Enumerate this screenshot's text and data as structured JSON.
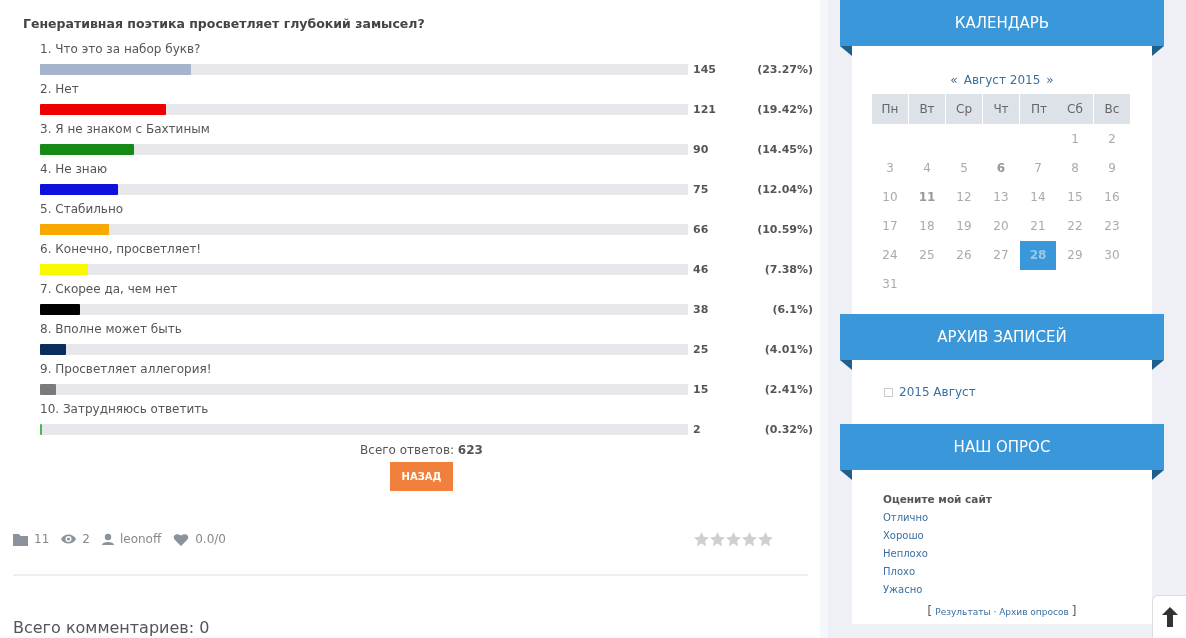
{
  "poll": {
    "question": "Генеративная поэтика просветляет глубокий замысел?",
    "answers": [
      {
        "label": "1. Что это за набор букв?",
        "count": "145",
        "percent": "(23.27%)",
        "level": 0.2327,
        "color": "#a3b4cc"
      },
      {
        "label": "2. Нет",
        "count": "121",
        "percent": "(19.42%)",
        "level": 0.1942,
        "color": "#ee0000"
      },
      {
        "label": "3. Я не знаком с Бахтиным",
        "count": "90",
        "percent": "(14.45%)",
        "level": 0.1445,
        "color": "#168a16"
      },
      {
        "label": "4. Не знаю",
        "count": "75",
        "percent": "(12.04%)",
        "level": 0.1204,
        "color": "#1010dd"
      },
      {
        "label": "5. Стабильно",
        "count": "66",
        "percent": "(10.59%)",
        "level": 0.1059,
        "color": "#f8a800"
      },
      {
        "label": "6. Конечно, просветляет!",
        "count": "46",
        "percent": "(7.38%)",
        "level": 0.0738,
        "color": "#f8f800"
      },
      {
        "label": "7. Скорее да, чем нет",
        "count": "38",
        "percent": "(6.1%)",
        "level": 0.061,
        "color": "#000000"
      },
      {
        "label": "8. Вполне может быть",
        "count": "25",
        "percent": "(4.01%)",
        "level": 0.0401,
        "color": "#0a2d5c"
      },
      {
        "label": "9. Просветляет аллегория!",
        "count": "15",
        "percent": "(2.41%)",
        "level": 0.0241,
        "color": "#7a7a7a"
      },
      {
        "label": "10. Затрудняюсь ответить",
        "count": "2",
        "percent": "(0.32%)",
        "level": 0.0032,
        "color": "#44bb44"
      }
    ],
    "total_label": "Всего ответов:",
    "total": "623",
    "back_button": "НАЗАД"
  },
  "meta": {
    "category": "11",
    "views": "2",
    "author": "leonoff",
    "rating": "0.0/0",
    "stars": 0
  },
  "comments": "Всего комментариев: 0",
  "calendar": {
    "title": "КАЛЕНДАРЬ",
    "prev": "«",
    "month": "Август 2015",
    "next": "»",
    "weekdays": [
      "Пн",
      "Вт",
      "Ср",
      "Чт",
      "Пт",
      "Сб",
      "Вс"
    ],
    "weeks": [
      [
        {
          "day": "1",
          "has_posts": false,
          "selected": false
        },
        {
          "day": "2",
          "has_posts": false,
          "selected": false
        }
      ],
      [
        {
          "day": "3",
          "has_posts": false,
          "selected": false
        },
        {
          "day": "4",
          "has_posts": false,
          "selected": false
        },
        {
          "day": "5",
          "has_posts": false,
          "selected": false
        },
        {
          "day": "6",
          "has_posts": true,
          "selected": false
        },
        {
          "day": "7",
          "has_posts": false,
          "selected": false
        },
        {
          "day": "8",
          "has_posts": false,
          "selected": false
        },
        {
          "day": "9",
          "has_posts": false,
          "selected": false
        }
      ],
      [
        {
          "day": "10",
          "has_posts": false,
          "selected": false
        },
        {
          "day": "11",
          "has_posts": true,
          "selected": false
        },
        {
          "day": "12",
          "has_posts": false,
          "selected": false
        },
        {
          "day": "13",
          "has_posts": false,
          "selected": false
        },
        {
          "day": "14",
          "has_posts": false,
          "selected": false
        },
        {
          "day": "15",
          "has_posts": false,
          "selected": false
        },
        {
          "day": "16",
          "has_posts": false,
          "selected": false
        }
      ],
      [
        {
          "day": "17",
          "has_posts": false,
          "selected": false
        },
        {
          "day": "18",
          "has_posts": false,
          "selected": false
        },
        {
          "day": "19",
          "has_posts": false,
          "selected": false
        },
        {
          "day": "20",
          "has_posts": false,
          "selected": false
        },
        {
          "day": "21",
          "has_posts": false,
          "selected": false
        },
        {
          "day": "22",
          "has_posts": false,
          "selected": false
        },
        {
          "day": "23",
          "has_posts": false,
          "selected": false
        }
      ],
      [
        {
          "day": "24",
          "has_posts": false,
          "selected": false
        },
        {
          "day": "25",
          "has_posts": false,
          "selected": false
        },
        {
          "day": "26",
          "has_posts": false,
          "selected": false
        },
        {
          "day": "27",
          "has_posts": false,
          "selected": false
        },
        {
          "day": "28",
          "has_posts": true,
          "selected": true
        },
        {
          "day": "29",
          "has_posts": false,
          "selected": false
        },
        {
          "day": "30",
          "has_posts": false,
          "selected": false
        }
      ],
      [
        {
          "day": "31",
          "has_posts": false,
          "selected": false
        }
      ]
    ]
  },
  "archive": {
    "title": "АРХИВ ЗАПИСЕЙ",
    "items": [
      "2015 Август"
    ]
  },
  "site_poll": {
    "title": "НАШ ОПРОС",
    "question": "Оцените мой сайт",
    "options": [
      "Отлично",
      "Хорошо",
      "Неплохо",
      "Плохо",
      "Ужасно"
    ],
    "links": [
      "Результаты",
      "Архив опросов"
    ],
    "open_bracket": "[",
    "separator": "·",
    "close_bracket": "]"
  }
}
